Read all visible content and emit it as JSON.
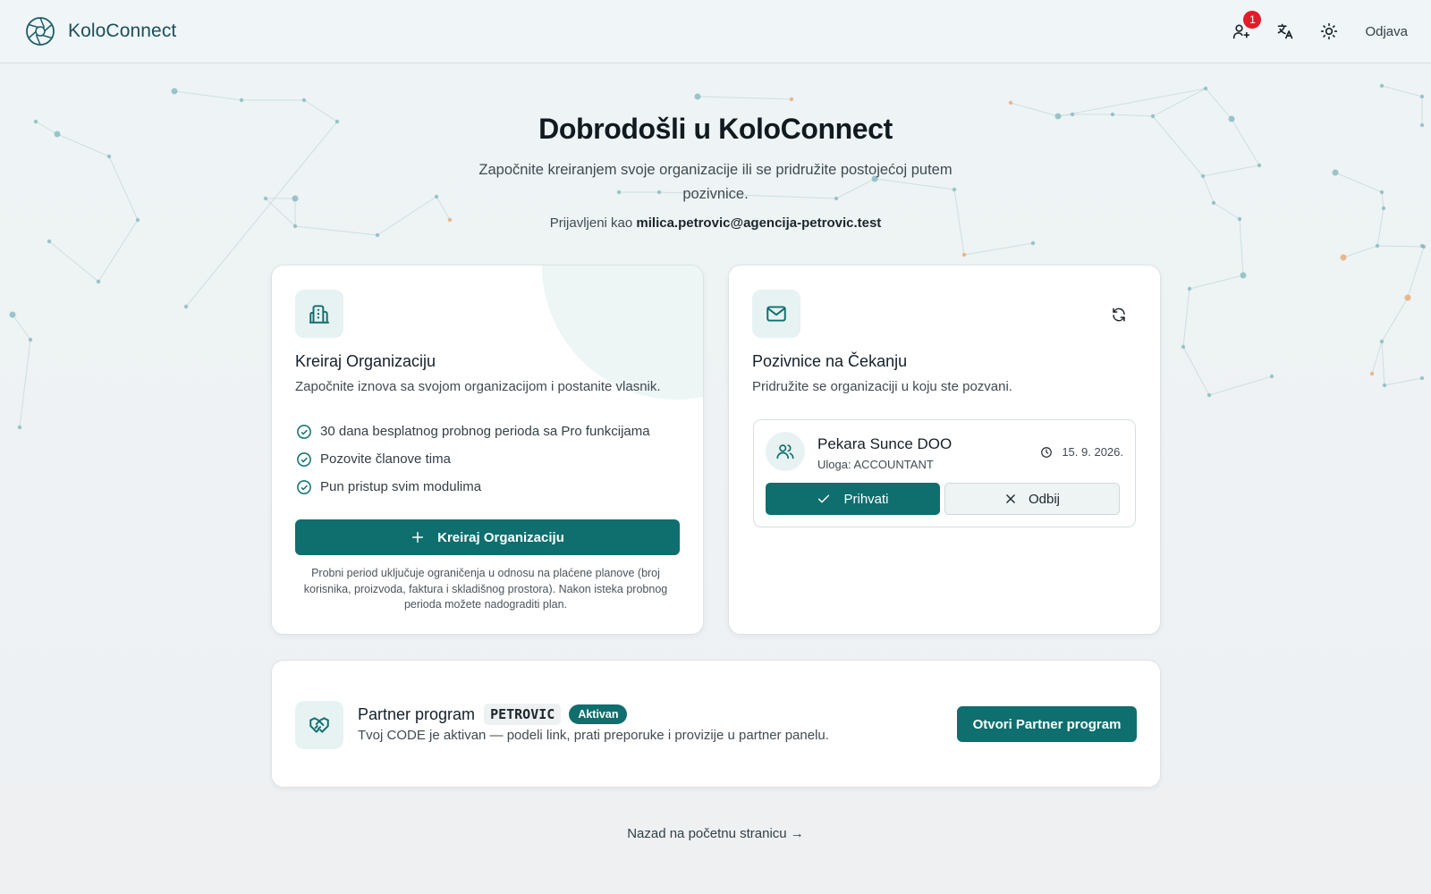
{
  "header": {
    "brand_name": "KoloConnect",
    "notification_count": "1",
    "logout_label": "Odjava"
  },
  "hero": {
    "title": "Dobrodošli u KoloConnect",
    "subtitle": "Započnite kreiranjem svoje organizacije ili se pridružite postojećoj putem pozivnice.",
    "logged_in_prefix": "Prijavljeni kao",
    "logged_in_email": "milica.petrovic@agencija-petrovic.test"
  },
  "create_card": {
    "title": "Kreiraj Organizaciju",
    "description": "Započnite iznova sa svojom organizacijom i postanite vlasnik.",
    "features": [
      "30 dana besplatnog probnog perioda sa Pro funkcijama",
      "Pozovite članove tima",
      "Pun pristup svim modulima"
    ],
    "button_label": "Kreiraj Organizaciju",
    "note": "Probni period uključuje ograničenja u odnosu na plaćene planove (broj korisnika, proizvoda, faktura i skladišnog prostora). Nakon isteka probnog perioda možete nadograditi plan."
  },
  "invites_card": {
    "title": "Pozivnice na Čekanju",
    "description": "Pridružite se organizaciji u koju ste pozvani.",
    "invites": [
      {
        "name": "Pekara Sunce DOO",
        "role": "Uloga: ACCOUNTANT",
        "date": "15. 9. 2026.",
        "accept_label": "Prihvati",
        "reject_label": "Odbij"
      }
    ]
  },
  "partner": {
    "title": "Partner program",
    "code": "PETROVIC",
    "status": "Aktivan",
    "description": "Tvoj CODE je aktivan — podeli link, prati preporuke i provizije u partner panelu.",
    "button_label": "Otvori Partner program"
  },
  "footer": {
    "back_link": "Nazad na početnu stranicu →"
  },
  "colors": {
    "primary": "#0f6e6e",
    "badge": "#e11d2a",
    "brand_text": "#1c4e5a"
  },
  "icons": {
    "brand": "aperture-icon",
    "notification": "user-plus-icon",
    "translate": "translate-icon",
    "theme": "sun-icon",
    "create_org": "building-icon",
    "invites": "mail-icon",
    "refresh": "refresh-icon",
    "invite_avatar": "users-icon",
    "date": "clock-icon",
    "partner": "handshake-icon"
  }
}
